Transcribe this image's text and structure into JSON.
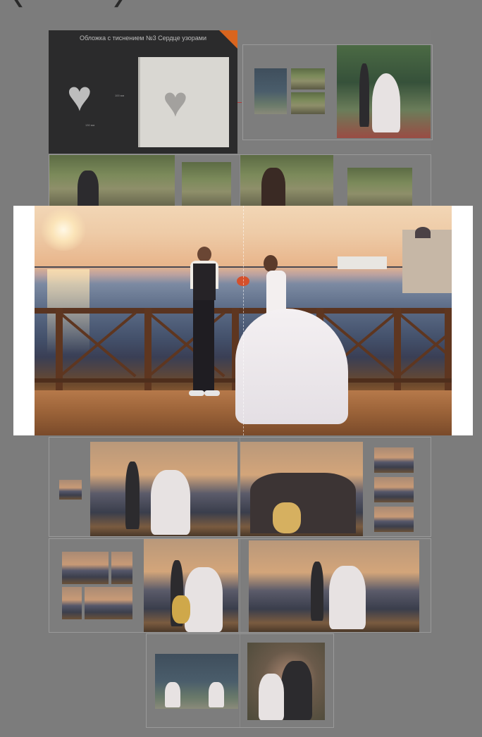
{
  "navigation": {
    "prev_icon": "chevron-left-icon",
    "next_icon": "chevron-right-icon",
    "prev_glyph": "❮",
    "next_glyph": "❯"
  },
  "album": {
    "cover": {
      "title": "Обложка с тиснением №3  Сердце узорами",
      "dim_height": "100 мм",
      "dim_width": "130 мм",
      "corner_color": "#d9651e"
    }
  },
  "colors": {
    "background": "#7c7c7c",
    "cover_background": "#2b2b2c",
    "overlay_background": "#ffffff"
  }
}
